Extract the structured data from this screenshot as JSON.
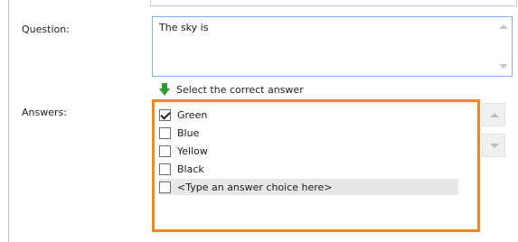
{
  "labels": {
    "question": "Question:",
    "answers": "Answers:"
  },
  "question": {
    "value": "The sky is"
  },
  "hint": {
    "icon": "green-down-arrow-icon",
    "text": "Select the correct answer"
  },
  "answers": [
    {
      "label": "Green",
      "checked": true
    },
    {
      "label": "Blue",
      "checked": false
    },
    {
      "label": "Yellow",
      "checked": false
    },
    {
      "label": "Black",
      "checked": false
    },
    {
      "label": "<Type an answer choice here>",
      "checked": false,
      "placeholder": true
    }
  ],
  "colors": {
    "answers_highlight": "#f5861f",
    "question_border": "#7fb4e6",
    "hint_icon": "#2e9b2e"
  }
}
